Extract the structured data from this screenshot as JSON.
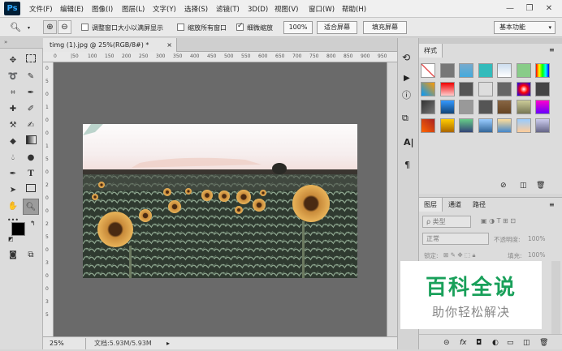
{
  "app": {
    "logo": "Ps"
  },
  "menu": [
    "文件(F)",
    "编辑(E)",
    "图像(I)",
    "图层(L)",
    "文字(Y)",
    "选择(S)",
    "滤镜(T)",
    "3D(D)",
    "视图(V)",
    "窗口(W)",
    "帮助(H)"
  ],
  "window_controls": {
    "minimize": "—",
    "restore": "❐",
    "close": "✕"
  },
  "options": {
    "resize_windows": "调整窗口大小以满屏显示",
    "zoom_all": "缩放所有窗口",
    "scrubby_zoom": "细微缩放",
    "zoom_value": "100%",
    "fit_screen": "适合屏幕",
    "fill_screen": "填充屏幕",
    "workspace": "基本功能"
  },
  "document": {
    "tab": "timg (1).jpg @ 25%(RGB/8#) *",
    "tab_close": "×",
    "ruler_top": [
      "0",
      "|50",
      "100",
      "150",
      "200",
      "250",
      "300",
      "350",
      "400",
      "450",
      "500",
      "550",
      "600",
      "650",
      "700",
      "750",
      "800",
      "850",
      "900",
      "950"
    ],
    "ruler_left": [
      "0",
      "5",
      "0",
      "1",
      "0",
      "0",
      "1",
      "5",
      "0",
      "2",
      "0",
      "0",
      "2",
      "5",
      "0",
      "3",
      "0",
      "0",
      "3",
      "5"
    ]
  },
  "status": {
    "zoom": "25%",
    "doc": "文档:5.93M/5.93M"
  },
  "panels": {
    "styles_title": "样式",
    "layers_tabs": [
      "图层",
      "通道",
      "路径"
    ],
    "kind_filter": "ρ 类型",
    "blend_mode": "正常",
    "opacity_label": "不透明度:",
    "opacity_value": "100%",
    "lock_label": "锁定:",
    "fill_label": "填充:",
    "fill_value": "100%"
  },
  "dock_icons": [
    "history-icon",
    "play-icon",
    "info-icon",
    "clone-source-icon",
    "character-icon",
    "paragraph-icon"
  ],
  "watermark": {
    "title": "百科全说",
    "subtitle": "助你轻松解决"
  },
  "colors": {
    "watermark_green": "#19a05a",
    "watermark_gray": "#888888",
    "canvas_gray": "#6a6a6a"
  }
}
